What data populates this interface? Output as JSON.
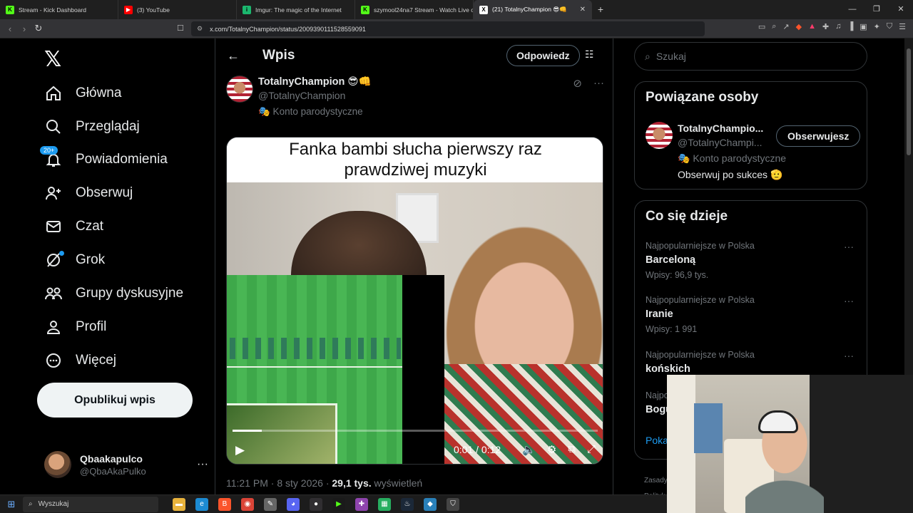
{
  "browser": {
    "tabs": [
      {
        "label": "Stream - Kick Dashboard",
        "color": "#53fc18",
        "glyph": "K"
      },
      {
        "label": "(3) YouTube",
        "color": "#ff0000",
        "glyph": "▶"
      },
      {
        "label": "Imgur: The magic of the Internet",
        "color": "#1bb76e",
        "glyph": "i"
      },
      {
        "label": "szymool24na7 Stream - Watch Live o",
        "color": "#53fc18",
        "glyph": "K"
      },
      {
        "label": "(21) TotalnyChampion 😎👊",
        "color": "#ffffff",
        "glyph": "X"
      }
    ],
    "url": "x.com/TotalnyChampion/status/2009390111528559091"
  },
  "nav": {
    "items": [
      {
        "label": "Główna",
        "icon": "home-icon"
      },
      {
        "label": "Przeglądaj",
        "icon": "search-icon"
      },
      {
        "label": "Powiadomienia",
        "icon": "bell-icon",
        "badge": "20+"
      },
      {
        "label": "Obserwuj",
        "icon": "person-add-icon"
      },
      {
        "label": "Czat",
        "icon": "mail-icon"
      },
      {
        "label": "Grok",
        "icon": "grok-icon"
      },
      {
        "label": "Grupy dyskusyjne",
        "icon": "communities-icon"
      },
      {
        "label": "Profil",
        "icon": "profile-icon"
      },
      {
        "label": "Więcej",
        "icon": "more-circle-icon"
      }
    ],
    "post_button": "Opublikuj wpis",
    "account": {
      "name": "Qbaakapulco",
      "handle": "@QbaAkaPulko"
    }
  },
  "main": {
    "title": "Wpis",
    "reply_button": "Odpowiedz",
    "tweet": {
      "author_name": "TotalnyChampion 😎👊",
      "author_handle": "@TotalnyChampion",
      "parody": "🎭 Konto parodystyczne",
      "video_caption_line1": "Fanka bambi słucha pierwszy raz",
      "video_caption_line2": "prawdziwej muzyki",
      "video_time": "0:01 / 0:12",
      "video_progress": 0.08,
      "timestamp": "11:21 PM · 8 sty 2026 · ",
      "views_count": "29,1 tys.",
      "views_label": " wyświetleń"
    }
  },
  "right": {
    "search_placeholder": "Szukaj",
    "related": {
      "title": "Powiązane osoby",
      "name": "TotalnyChampio...",
      "handle": "@TotalnyChampi...",
      "parody": "🎭 Konto parodystyczne",
      "bio": "Obserwuj po sukces 🫡",
      "follow_button": "Obserwujesz"
    },
    "trends": {
      "title": "Co się dzieje",
      "items": [
        {
          "category": "Najpopularniejsze w Polska",
          "name": "Barceloną",
          "count": "Wpisy: 96,9 tys."
        },
        {
          "category": "Najpopularniejsze w Polska",
          "name": "Iranie",
          "count": "Wpisy: 1 991"
        },
        {
          "category": "Najpopularniejsze w Polska",
          "name": "końskich",
          "count": ""
        },
        {
          "category": "Najpo",
          "name": "Bogu",
          "count": ""
        }
      ],
      "show_more": "Poka"
    },
    "footer": [
      "Zasady",
      "Polityk"
    ]
  },
  "taskbar": {
    "search_label": "Wyszukaj"
  }
}
